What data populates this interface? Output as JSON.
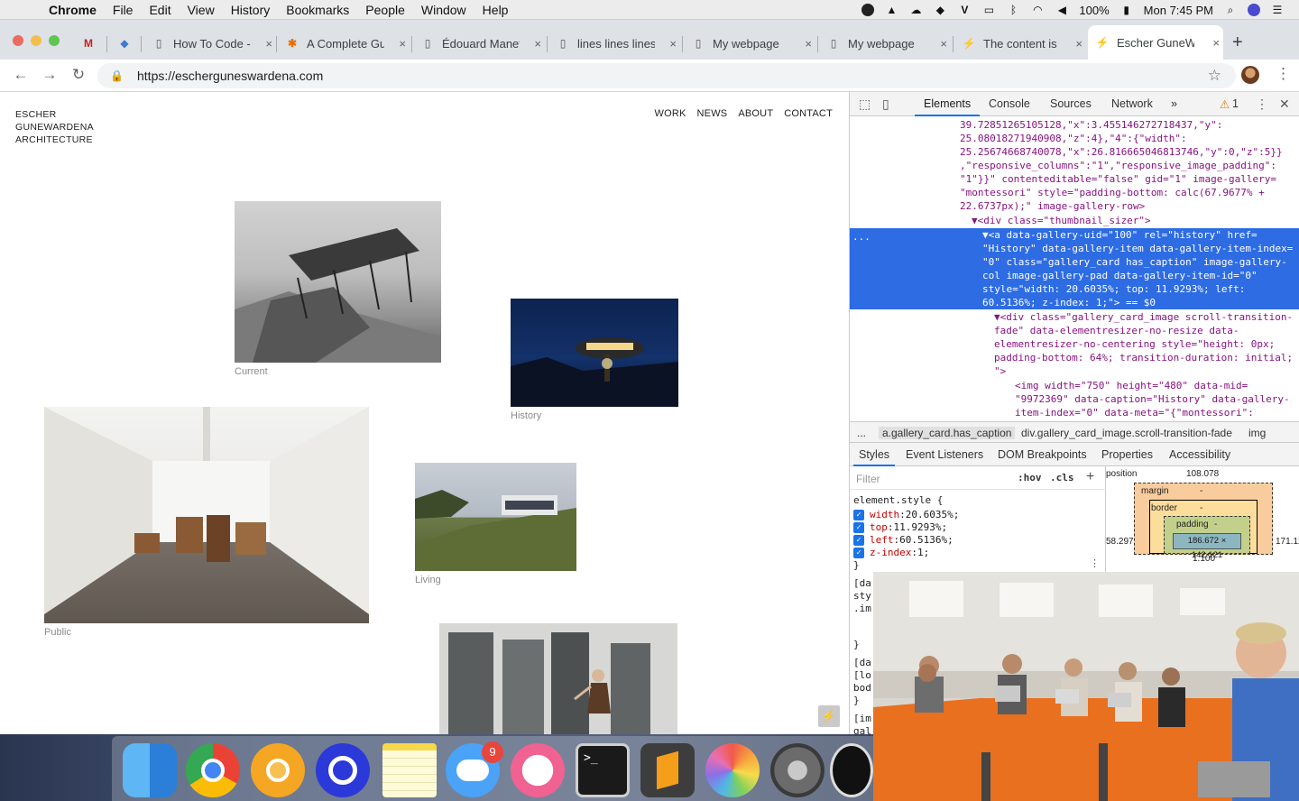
{
  "menubar": {
    "app": "Chrome",
    "menus": [
      "File",
      "Edit",
      "View",
      "History",
      "Bookmarks",
      "People",
      "Window",
      "Help"
    ],
    "battery": "100%",
    "clock": "Mon 7:45 PM"
  },
  "tabs": [
    {
      "icon": "gmail-icon",
      "title": ""
    },
    {
      "icon": "diamond-icon",
      "title": ""
    },
    {
      "icon": "page-icon",
      "title": "How To Code -"
    },
    {
      "icon": "asterisk-icon",
      "title": "A Complete Gu"
    },
    {
      "icon": "page-icon",
      "title": "Édouard Manet"
    },
    {
      "icon": "page-icon",
      "title": "lines lines lines"
    },
    {
      "icon": "page-icon",
      "title": "My webpage"
    },
    {
      "icon": "page-icon",
      "title": "My webpage"
    },
    {
      "icon": "lightning-icon",
      "title": "The content is"
    },
    {
      "icon": "lightning-icon",
      "title": "Escher GuneW"
    }
  ],
  "omnibox": {
    "url": "https://escherguneswardena.com"
  },
  "site": {
    "logo_lines": [
      "ESCHER",
      "GUNEWARDENA",
      "ARCHITECTURE"
    ],
    "nav": [
      "WORK",
      "NEWS",
      "ABOUT",
      "CONTACT"
    ],
    "gallery": [
      {
        "caption": "Current"
      },
      {
        "caption": "History"
      },
      {
        "caption": "Public"
      },
      {
        "caption": "Living"
      },
      {
        "caption": ""
      }
    ]
  },
  "devtools": {
    "tabs": [
      "Elements",
      "Console",
      "Sources",
      "Network"
    ],
    "more": "»",
    "warnings": "1",
    "code_lines": [
      "39.72851265105128,\"x\":3.455146272718437,\"y\":",
      "25.08018271940908,\"z\":4},\"4\":{\"width\":",
      "25.25674668740078,\"x\":26.816665046813746,\"y\":0,\"z\":5}}",
      ",\"responsive_columns\":\"1\",\"responsive_image_padding\":",
      "\"1\"}}\" contenteditable=\"false\" gid=\"1\" image-gallery=",
      "\"montessori\" style=\"padding-bottom: calc(67.9677% +",
      "22.6737px);\" image-gallery-row>",
      "▼<div class=\"thumbnail_sizer\">",
      "▼<a data-gallery-uid=\"100\" rel=\"history\" href=",
      "\"History\" data-gallery-item data-gallery-item-index=",
      "\"0\" class=\"gallery_card has_caption\" image-gallery-",
      "col image-gallery-pad data-gallery-item-id=\"0\"",
      "style=\"width: 20.6035%; top: 11.9293%; left:",
      "60.5136%; z-index: 1;\"> == $0",
      "▼<div class=\"gallery_card_image scroll-transition-",
      "fade\" data-elementresizer-no-resize data-",
      "elementresizer-no-centering style=\"height: 0px;",
      "padding-bottom: 64%; transition-duration: initial;",
      "\">",
      "<img width=\"750\" height=\"480\" data-mid=",
      "\"9972369\" data-caption=\"History\" data-gallery-",
      "item-index=\"0\" data-meta=\"{\"montessori\":"
    ],
    "selected_ellipsis": "...",
    "breadcrumbs": [
      "...",
      "a.gallery_card.has_caption",
      "div.gallery_card_image.scroll-transition-fade",
      "img"
    ],
    "subtabs": [
      "Styles",
      "Event Listeners",
      "DOM Breakpoints",
      "Properties",
      "Accessibility"
    ],
    "filter_placeholder": "Filter",
    "hov": ":hov",
    "cls": ".cls",
    "element_style": "element.style {",
    "props": [
      {
        "name": "width",
        "value": "20.6035%;"
      },
      {
        "name": "top",
        "value": "11.9293%;"
      },
      {
        "name": "left",
        "value": "60.5136%;"
      },
      {
        "name": "z-index",
        "value": "1;"
      }
    ],
    "close_brace": "}",
    "more_rules": [
      "[da",
      "sty",
      ".im",
      "}",
      "[da",
      "[lo",
      "bod",
      "}",
      "[im",
      "gal"
    ],
    "boxmodel": {
      "position_label": "position",
      "position_value": "108.078",
      "margin": "margin",
      "border": "border",
      "padding": "padding",
      "content": "186.672 × 142.121",
      "left_value": "58.297",
      "right_value": "171.12",
      "dash": "-",
      "bottom_hint": "1.100"
    }
  },
  "dock": {
    "messages_badge": "9"
  }
}
